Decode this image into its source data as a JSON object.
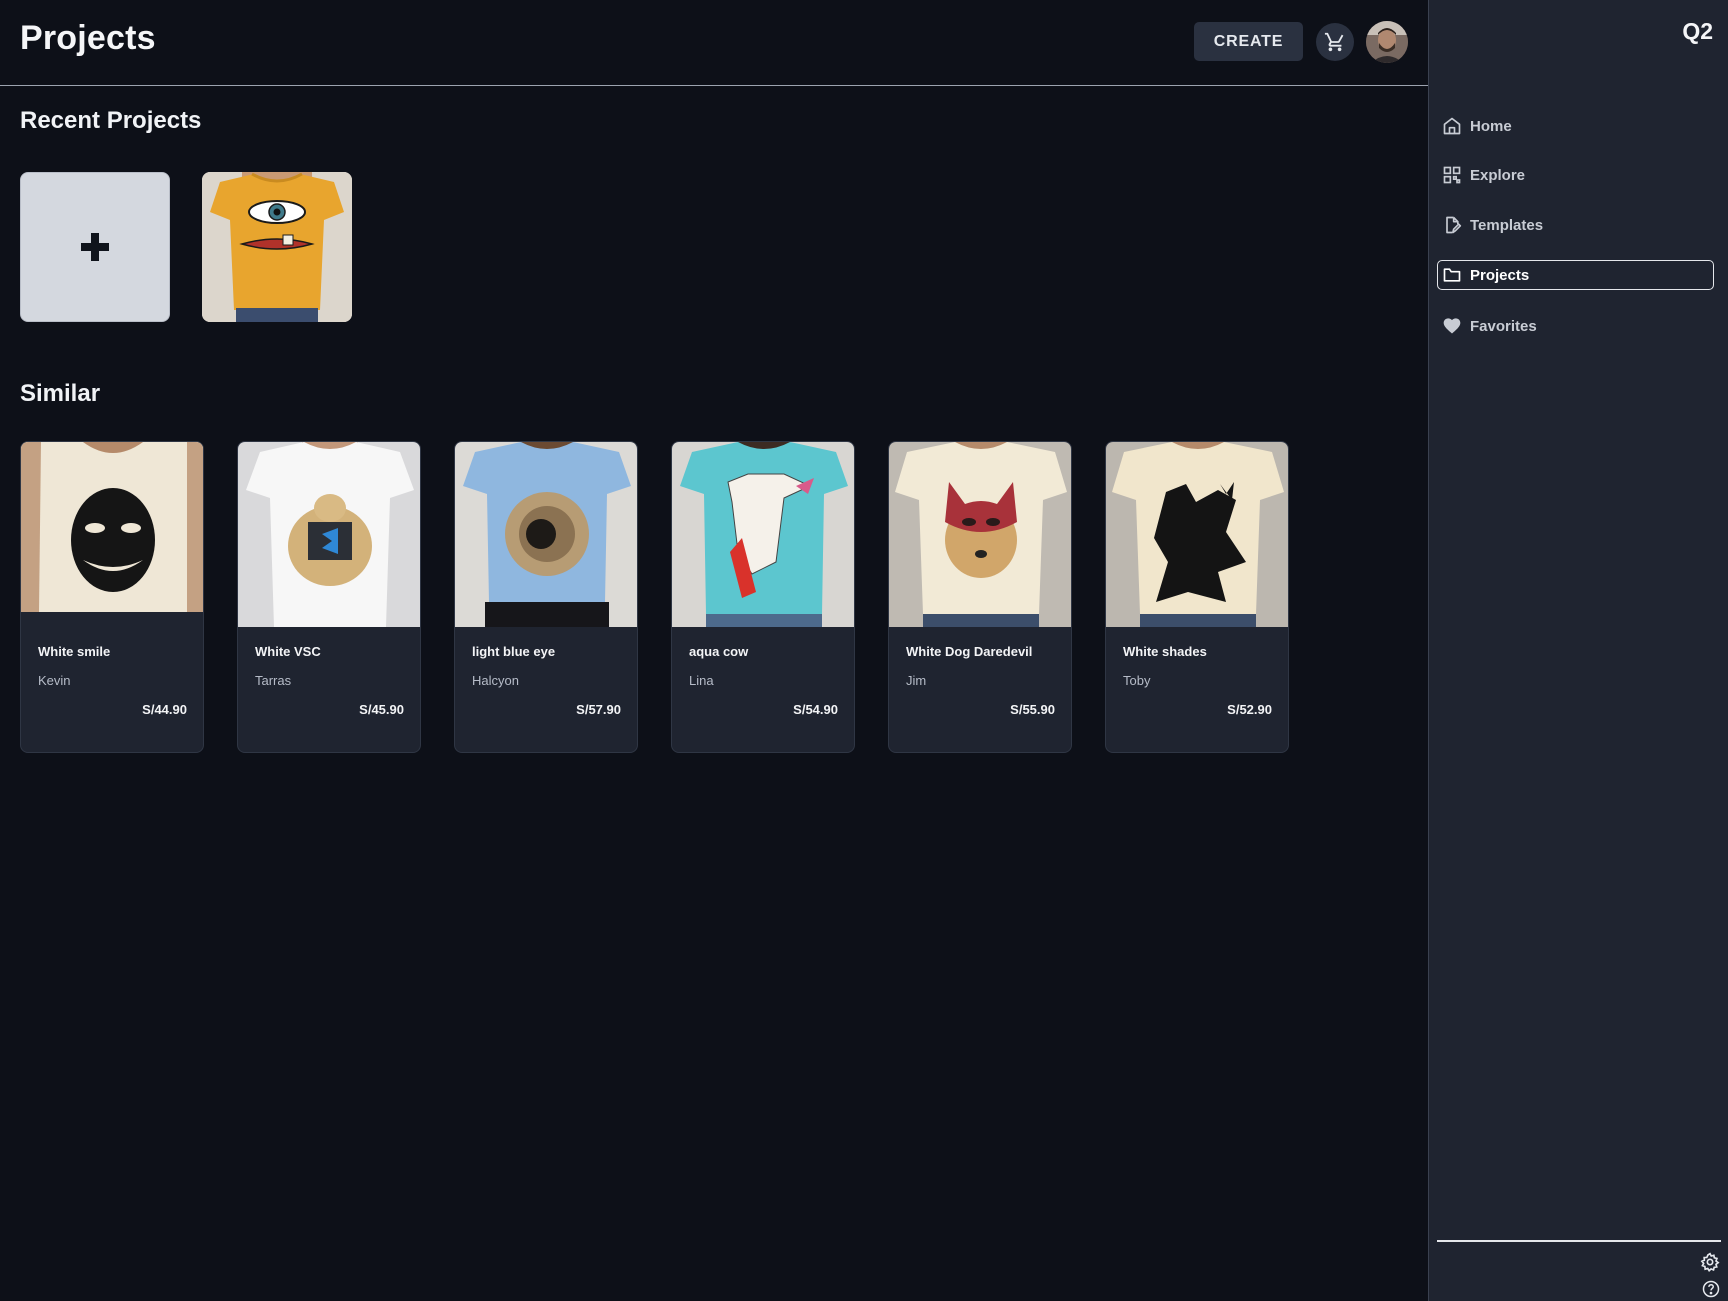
{
  "header": {
    "title": "Projects",
    "create_label": "CREATE",
    "cart_icon": "cart-icon",
    "avatar": "user-avatar"
  },
  "recent": {
    "title": "Recent Projects",
    "new_icon": "plus-icon"
  },
  "similar": {
    "title": "Similar",
    "items": [
      {
        "name": "White smile",
        "author": "Kevin",
        "price": "S/44.90"
      },
      {
        "name": "White VSC",
        "author": "Tarras",
        "price": "S/45.90"
      },
      {
        "name": "light blue eye",
        "author": "Halcyon",
        "price": "S/57.90"
      },
      {
        "name": "aqua cow",
        "author": "Lina",
        "price": "S/54.90"
      },
      {
        "name": "White Dog Daredevil",
        "author": "Jim",
        "price": "S/55.90"
      },
      {
        "name": "White shades",
        "author": "Toby",
        "price": "S/52.90"
      }
    ]
  },
  "sidebar": {
    "brand": "Q2",
    "items": [
      {
        "label": "Home",
        "icon": "home-icon"
      },
      {
        "label": "Explore",
        "icon": "grid-icon"
      },
      {
        "label": "Templates",
        "icon": "document-edit-icon"
      },
      {
        "label": "Projects",
        "icon": "folder-icon",
        "active": true
      },
      {
        "label": "Favorites",
        "icon": "heart-icon"
      }
    ],
    "footer_icons": [
      "gear-icon",
      "help-icon"
    ]
  },
  "colors": {
    "background": "#0d1018",
    "panel": "#1f2430",
    "button": "#2a3140",
    "text": "#f1f3f6"
  }
}
